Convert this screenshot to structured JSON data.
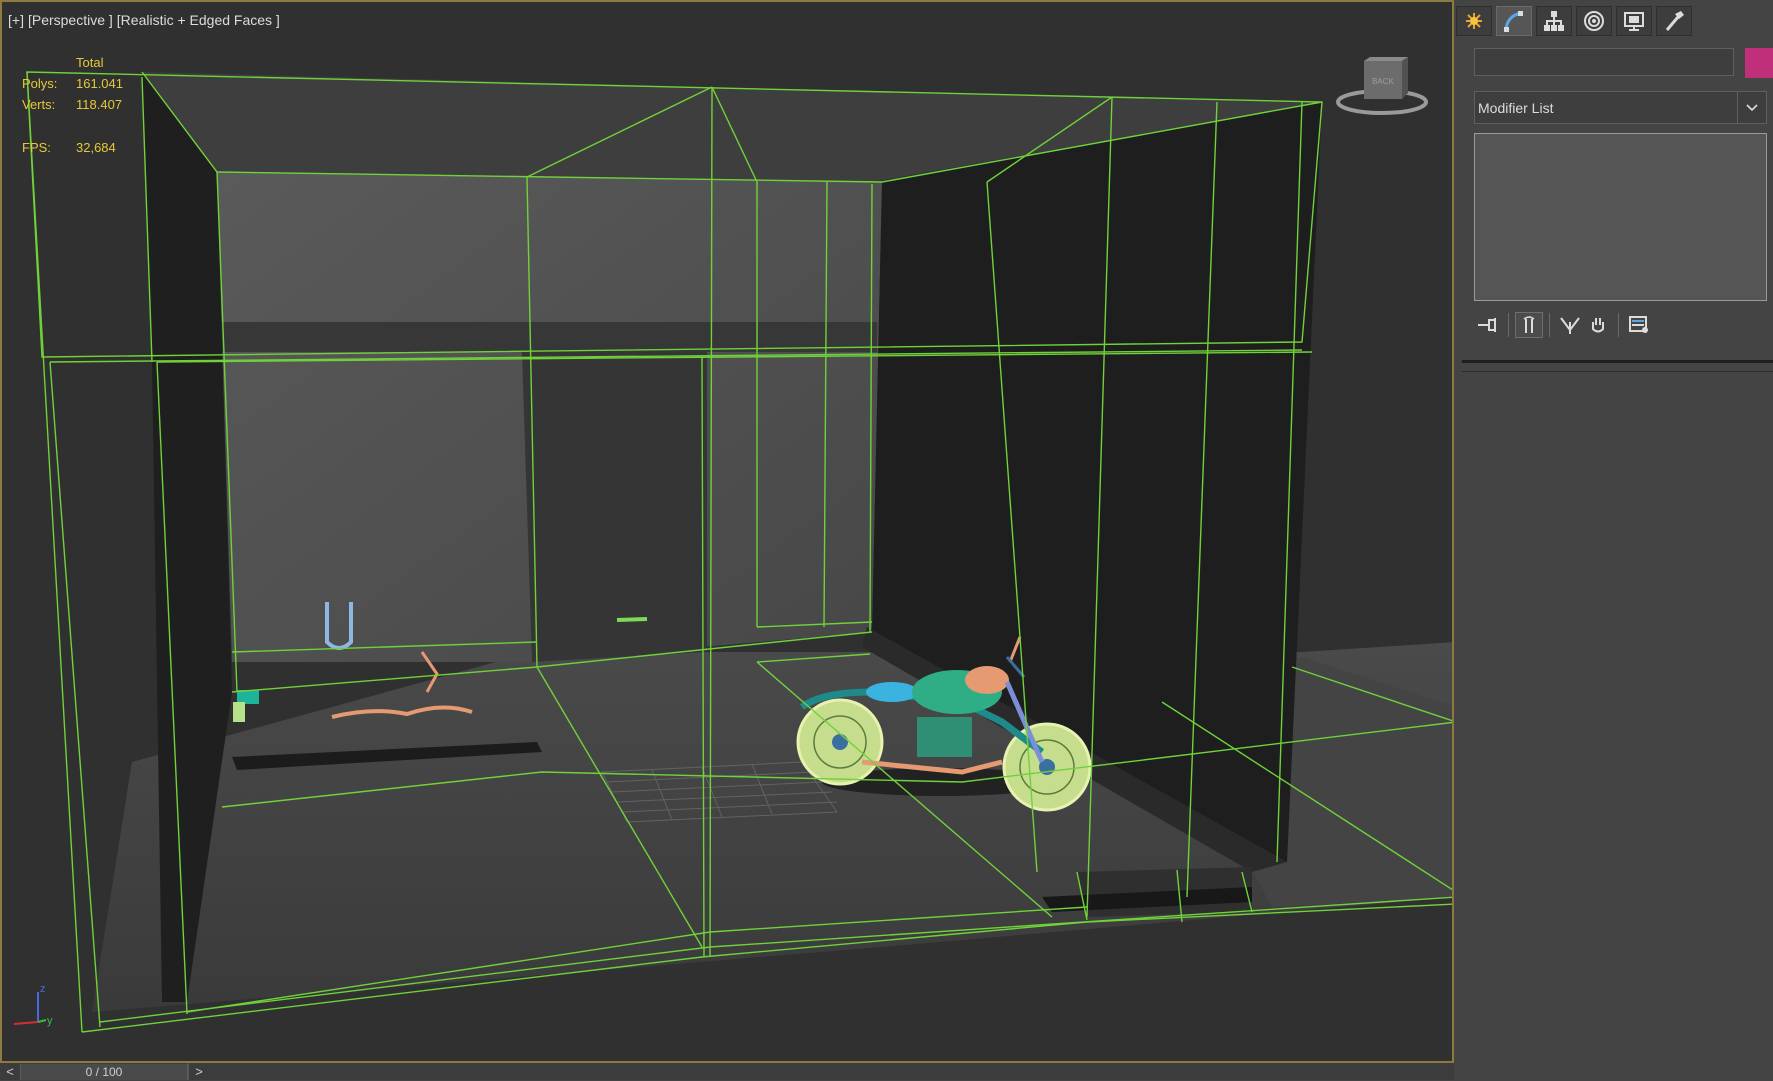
{
  "viewport": {
    "label_plus": "[+]",
    "label_view": "[Perspective ]",
    "label_shading": "[Realistic + Edged Faces ]",
    "stats": {
      "total_label": "Total",
      "polys_label": "Polys:",
      "polys_value": "161.041",
      "verts_label": "Verts:",
      "verts_value": "118.407",
      "fps_label": "FPS:",
      "fps_value": "32,684"
    },
    "viewcube_face": "BACK",
    "axis": {
      "z": "z",
      "y": "y"
    }
  },
  "timeline": {
    "prev": "<",
    "position": "0 / 100",
    "next": ">"
  },
  "command_panel": {
    "tabs": [
      {
        "name": "create",
        "icon": "create-icon",
        "active": false
      },
      {
        "name": "modify",
        "icon": "modify-icon",
        "active": true
      },
      {
        "name": "hierarchy",
        "icon": "hierarchy-icon",
        "active": false
      },
      {
        "name": "motion",
        "icon": "motion-icon",
        "active": false
      },
      {
        "name": "display",
        "icon": "display-icon",
        "active": false
      },
      {
        "name": "utilities",
        "icon": "utilities-icon",
        "active": false
      }
    ],
    "object_name": "",
    "object_color": "#c0307a",
    "modifier_list": "Modifier List",
    "stack_tools": [
      "pin-stack-icon",
      "show-end-result-icon",
      "make-unique-icon",
      "remove-modifier-icon",
      "configure-modifier-sets-icon"
    ]
  },
  "colors": {
    "selection_wire": "#6fd23a",
    "stats_text": "#e5c93a",
    "viewport_border": "#8c7a3e"
  }
}
